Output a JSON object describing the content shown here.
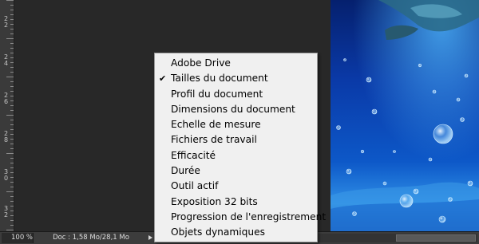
{
  "ruler": {
    "labels": [
      "2\n2",
      "2\n4",
      "2\n6",
      "2\n8",
      "3\n0",
      "3\n2"
    ]
  },
  "statusbar": {
    "zoom": "100 %",
    "doc_info": "Doc : 1,58 Mo/28,1 Mo",
    "menu_arrow_icon": "triangle-right-icon"
  },
  "menu": {
    "checked_icon": "checkmark-icon",
    "items": [
      {
        "label": "Adobe Drive",
        "checked": false
      },
      {
        "label": "Tailles du document",
        "checked": true
      },
      {
        "label": "Profil du document",
        "checked": false
      },
      {
        "label": "Dimensions du document",
        "checked": false
      },
      {
        "label": "Echelle de mesure",
        "checked": false
      },
      {
        "label": "Fichiers de travail",
        "checked": false
      },
      {
        "label": "Efficacité",
        "checked": false
      },
      {
        "label": "Durée",
        "checked": false
      },
      {
        "label": "Outil actif",
        "checked": false
      },
      {
        "label": "Exposition 32 bits",
        "checked": false
      },
      {
        "label": "Progression de l'enregistrement",
        "checked": false
      },
      {
        "label": "Objets dynamiques",
        "checked": false
      }
    ]
  },
  "colors": {
    "workspace": "#282828",
    "ruler": "#3a3a3a",
    "menu_bg": "#f0f0f0",
    "water_deep": "#04175a",
    "water_light": "#2e8fe6"
  }
}
